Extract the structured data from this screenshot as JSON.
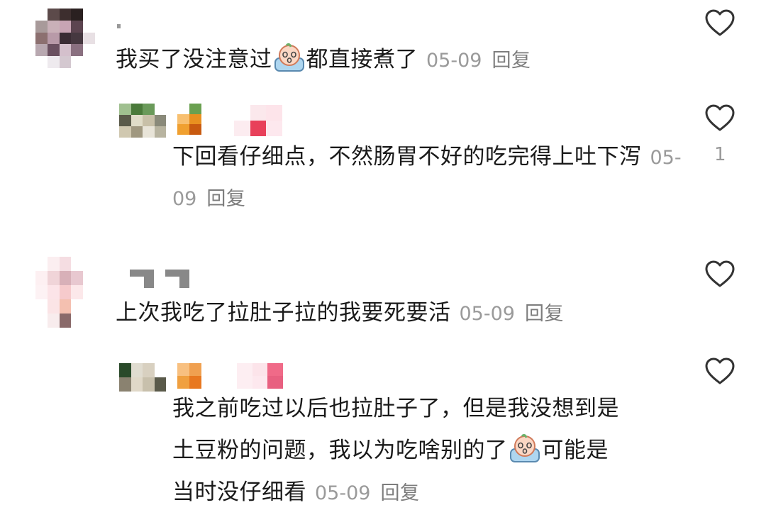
{
  "comments": [
    {
      "text_before": "我买了没注意过",
      "emoji": "crying-face-emoji",
      "text_after": "都直接煮了",
      "date": "05-09",
      "reply_label": "回复",
      "replies": [
        {
          "text": "下回看仔细点，不然肠胃不好的吃完得上吐下泻",
          "date": "05-09",
          "reply_label": "回复",
          "like_count": "1"
        }
      ]
    },
    {
      "text": "上次我吃了拉肚子拉的我要死要活",
      "date": "05-09",
      "reply_label": "回复",
      "replies": [
        {
          "line1": "我之前吃过以后也拉肚子了，但是我没想到是",
          "line2_before": "土豆粉的问题，我以为吃啥别的了",
          "emoji": "crying-face-emoji",
          "line2_after": "可能是",
          "line3": "当时没仔细看",
          "date": "05-09",
          "reply_label": "回复"
        }
      ]
    }
  ],
  "icons": {
    "like": "heart-outline-icon"
  },
  "colors": {
    "text": "#1a1a1a",
    "meta": "#9a9a9a",
    "like_stroke": "#333333"
  }
}
